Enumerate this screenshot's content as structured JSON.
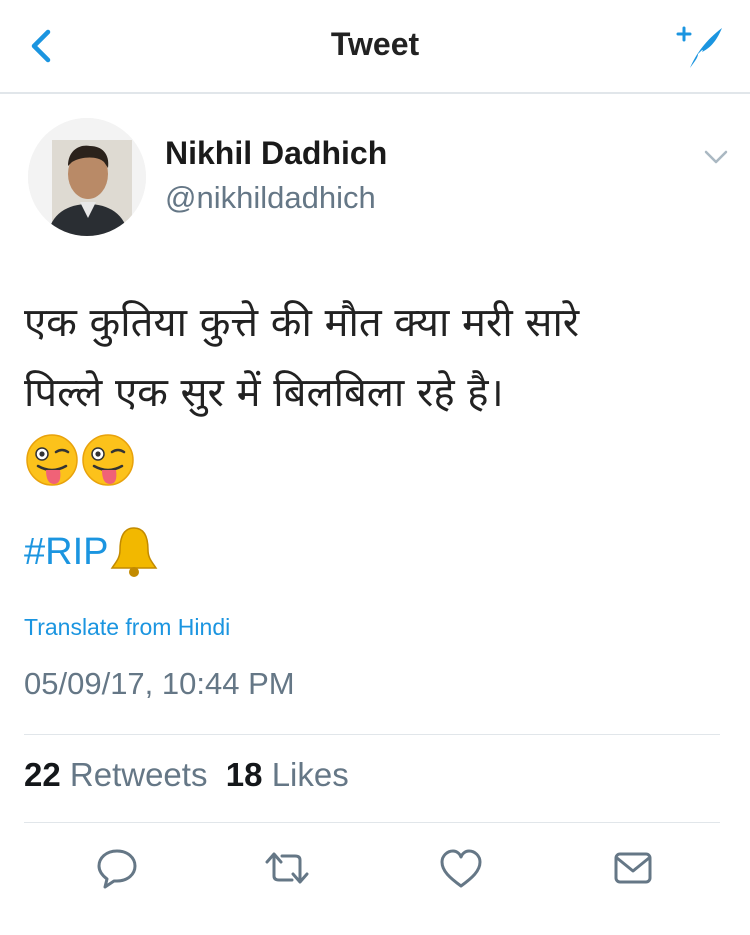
{
  "header": {
    "title": "Tweet"
  },
  "author": {
    "name": "Nikhil Dadhich",
    "handle": "@nikhildadhich"
  },
  "tweet": {
    "text_lines": [
      "एक कुतिया कुत्ते की मौत क्या मरी सारे",
      "पिल्ले एक सुर में बिलबिला रहे है।"
    ],
    "emojis": [
      "winking-face-with-tongue",
      "winking-face-with-tongue"
    ],
    "hashtag": "#RIP",
    "hashtag_emoji": "bell",
    "translate_label": "Translate from Hindi",
    "timestamp": "05/09/17, 10:44 PM"
  },
  "stats": {
    "retweets_count": "22",
    "retweets_label": "Retweets",
    "likes_count": "18",
    "likes_label": "Likes"
  },
  "actions": [
    "reply-icon",
    "retweet-icon",
    "like-icon",
    "share-icon"
  ],
  "colors": {
    "accent": "#1b95e0",
    "secondary_text": "#657786",
    "primary_text": "#14171a",
    "divider": "#e1e6ea"
  }
}
